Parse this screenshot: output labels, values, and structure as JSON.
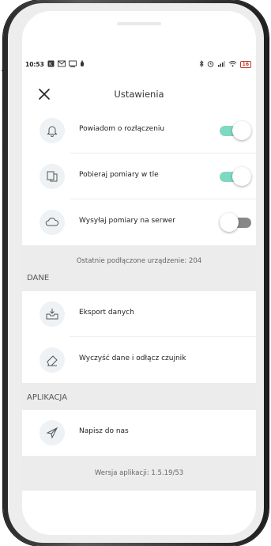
{
  "status_bar": {
    "time": "10:53",
    "left_icons": [
      "app-notification-icon",
      "mail-icon",
      "cast-icon",
      "alarm-icon"
    ],
    "right_icons": [
      "bluetooth-icon",
      "alarm-clock-icon",
      "signal-icon",
      "wifi-icon",
      "battery-icon"
    ],
    "battery": "16"
  },
  "header": {
    "title": "Ustawienia",
    "close_icon": "close-icon"
  },
  "settings": {
    "toggles": [
      {
        "label": "Powiadom o rozłączeniu",
        "icon": "bell-icon",
        "on": true
      },
      {
        "label": "Pobieraj pomiary w tle",
        "icon": "copy-icon",
        "on": true
      },
      {
        "label": "Wysyłaj pomiary na serwer",
        "icon": "cloud-icon",
        "on": false
      }
    ],
    "last_device": "Ostatnie podłączone urządzenie: 204"
  },
  "data_section": {
    "title": "DANE",
    "items": [
      {
        "label": "Eksport danych",
        "icon": "export-inbox-icon"
      },
      {
        "label": "Wyczyść dane i odłącz czujnik",
        "icon": "eraser-icon"
      }
    ]
  },
  "app_section": {
    "title": "APLIKACJA",
    "items": [
      {
        "label": "Napisz do nas",
        "icon": "send-icon"
      }
    ],
    "version": "Wersja aplikacji: 1.5.19/53"
  },
  "colors": {
    "toggle_on": "#7fd8c2",
    "toggle_off": "#888888",
    "band": "#ececec"
  }
}
